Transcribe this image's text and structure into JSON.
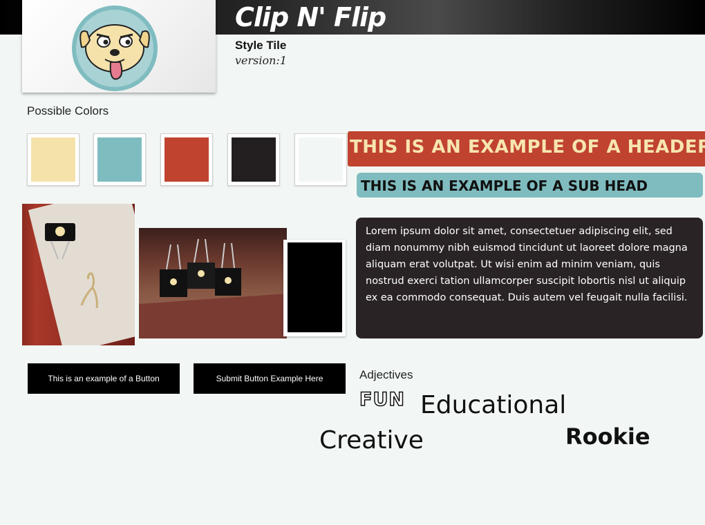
{
  "header": {
    "app_title": "Clip N' Flip",
    "subtitle": "Style Tile",
    "version": "version:1"
  },
  "colors": {
    "label": "Possible Colors",
    "swatches": [
      "#f5e2ab",
      "#7fbcc0",
      "#c0432f",
      "#231f20",
      "#f2f7f5"
    ]
  },
  "typography": {
    "header_example": "This is an example of a header",
    "subhead_example": "This is an example of a sub head",
    "body_text": "Lorem ipsum dolor sit amet, consectetuer adipiscing elit, sed diam nonummy nibh euismod tincidunt ut laoreet dolore magna aliquam erat volutpat. Ut wisi enim ad minim veniam, quis nostrud exerci tation ullamcorper suscipit lobortis nisl ut aliquip ex ea commodo consequat. Duis autem vel feugait nulla facilisi."
  },
  "buttons": {
    "example_label": "This is an example of a Button",
    "submit_label": "Submit Button Example Here"
  },
  "adjectives": {
    "label": "Adjectives",
    "items": [
      "FUN",
      "Educational",
      "Creative",
      "Rookie"
    ]
  }
}
